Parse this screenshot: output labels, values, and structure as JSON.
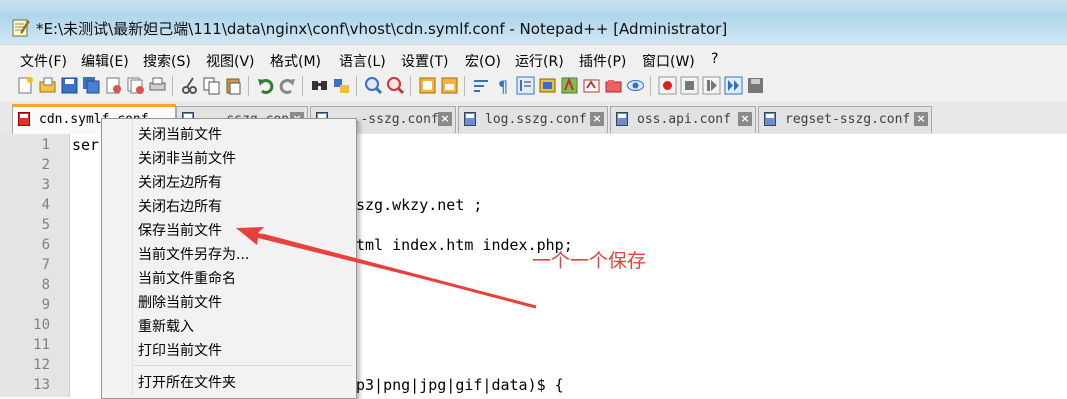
{
  "window": {
    "title": "*E:\\未测试\\最新妲己端\\111\\data\\nginx\\conf\\vhost\\cdn.symlf.conf - Notepad++ [Administrator]"
  },
  "menu": [
    "文件(F)",
    "编辑(E)",
    "搜索(S)",
    "视图(V)",
    "格式(M)",
    "语言(L)",
    "设置(T)",
    "宏(O)",
    "运行(R)",
    "插件(P)",
    "窗口(W)",
    "?"
  ],
  "tabs": [
    {
      "label": "cdn.symlf.conf",
      "active": true
    },
    {
      "label": "...sszg.conf"
    },
    {
      "label": "...-sszg.conf"
    },
    {
      "label": "log.sszg.conf"
    },
    {
      "label": "oss.api.conf"
    },
    {
      "label": "regset-sszg.conf"
    }
  ],
  "line_numbers": [
    "1",
    "2",
    "3",
    "4",
    "5",
    "6",
    "7",
    "8",
    "9",
    "10",
    "11",
    "12",
    "13"
  ],
  "code_fragments": {
    "line1": "ser",
    "line4": "szg.wkzy.net ;",
    "line6": "tml index.htm index.php;",
    "line13": "p3|png|jpg|gif|data)$ {"
  },
  "context_menu": {
    "items": [
      "关闭当前文件",
      "关闭非当前文件",
      "关闭左边所有",
      "关闭右边所有",
      "保存当前文件",
      "当前文件另存为...",
      "当前文件重命名",
      "删除当前文件",
      "重新载入",
      "打印当前文件",
      "打开所在文件夹"
    ]
  },
  "annotation": {
    "text": "一个一个保存",
    "color": "#e8403a"
  },
  "colors": {
    "accent_tab": "#f5a623",
    "annotation_red": "#e8403a"
  }
}
